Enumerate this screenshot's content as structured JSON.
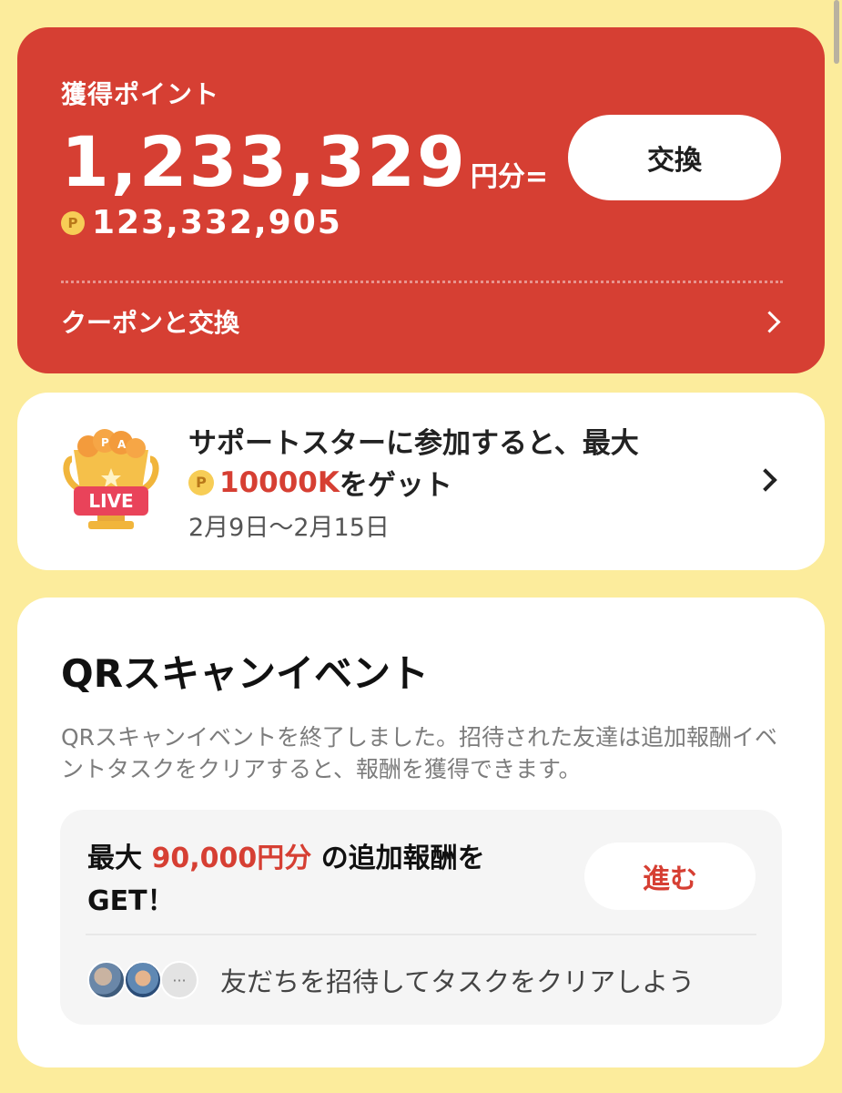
{
  "points_card": {
    "title": "獲得ポイント",
    "amount": "1,233,329",
    "unit": "円分=",
    "points_icon": "P",
    "points_value": "123,332,905",
    "exchange_button": "交換",
    "coupon_label": "クーポンと交換"
  },
  "live_card": {
    "line1": "サポートスターに参加すると、最大",
    "coin_icon": "P",
    "highlight": "10000K",
    "line2_rest": "をゲット",
    "date": "2月9日〜2月15日",
    "badge": "LIVE"
  },
  "qr_card": {
    "title": "QRスキャンイベント",
    "description": "QRスキャンイベントを終了しました。招待された友達は追加報酬イベントタスクをクリアすると、報酬を獲得できます。",
    "reward_prefix": "最大",
    "reward_amount": "90,000円分",
    "reward_suffix": "の追加報酬を",
    "reward_line2": "GET！",
    "go_button": "進む",
    "more_avatars": "···",
    "invite_text": "友だちを招待してタスクをクリアしよう"
  },
  "colors": {
    "background": "#fcec9c",
    "brand_red": "#d63f33",
    "coin": "#f7cd56"
  }
}
